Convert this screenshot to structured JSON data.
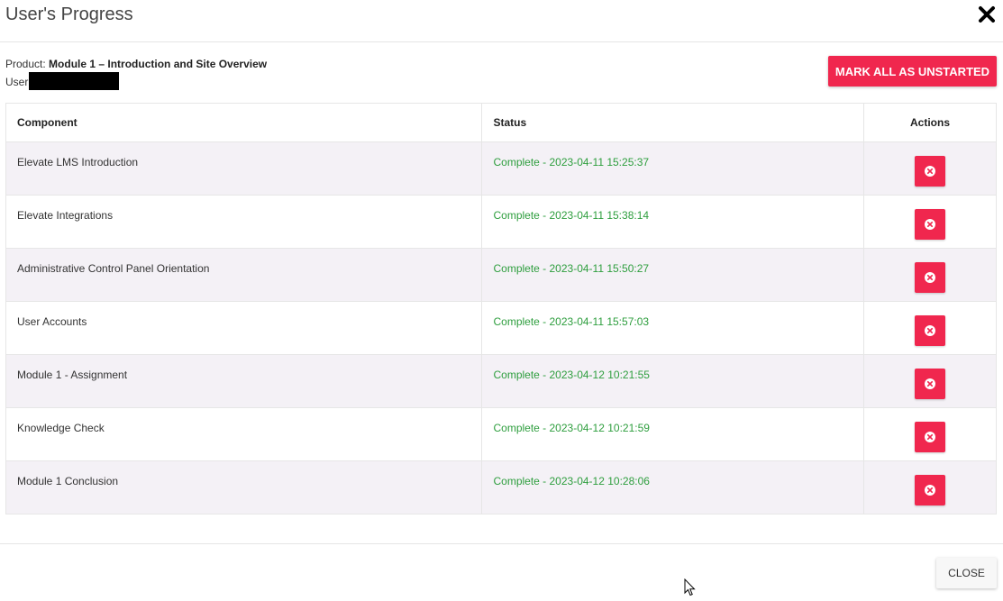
{
  "modal": {
    "title": "User's Progress",
    "close_icon": "close-x-icon"
  },
  "meta": {
    "product_label": "Product:",
    "product_name": "Module 1 – Introduction and Site Overview",
    "user_label": "User"
  },
  "mark_all_label": "MARK ALL AS UNSTARTED",
  "table": {
    "headers": [
      "Component",
      "Status",
      "Actions"
    ],
    "rows": [
      {
        "component": "Elevate LMS Introduction",
        "status": "Complete - 2023-04-11 15:25:37"
      },
      {
        "component": "Elevate Integrations",
        "status": "Complete - 2023-04-11 15:38:14"
      },
      {
        "component": "Administrative Control Panel Orientation",
        "status": "Complete - 2023-04-11 15:50:27"
      },
      {
        "component": "User Accounts",
        "status": "Complete - 2023-04-11 15:57:03"
      },
      {
        "component": "Module 1 - Assignment",
        "status": "Complete - 2023-04-12 10:21:55"
      },
      {
        "component": "Knowledge Check",
        "status": "Complete - 2023-04-12 10:21:59"
      },
      {
        "component": "Module 1 Conclusion",
        "status": "Complete - 2023-04-12 10:28:06"
      }
    ],
    "row_action_icon": "times-circle-icon"
  },
  "footer": {
    "close_label": "CLOSE"
  },
  "colors": {
    "accent": "#f0274e",
    "status_complete": "#2e9e3e",
    "row_stripe": "#f4f1f6"
  }
}
